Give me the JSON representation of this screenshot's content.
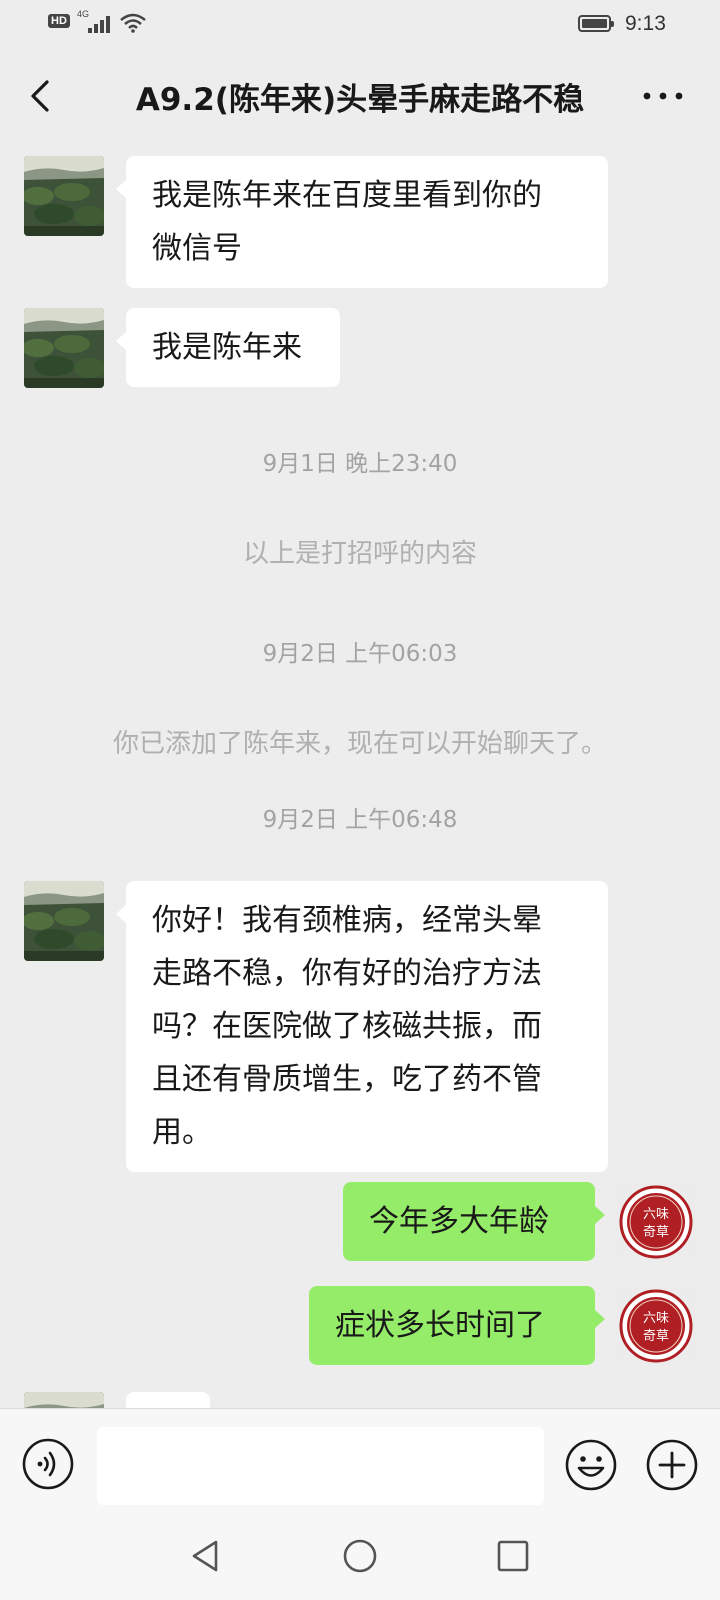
{
  "status_bar": {
    "hd": "HD",
    "network": "4G",
    "time": "9:13"
  },
  "header": {
    "title": "A9.2(陈年来)头晕手麻走路不稳"
  },
  "messages": [
    {
      "lines": [
        "我是陈年来在百度里看到你的",
        "微信号"
      ]
    },
    {
      "lines": [
        "我是陈年来"
      ]
    },
    {
      "lines": [
        "你好！我有颈椎病，经常头晕",
        "走路不稳，你有好的治疗方法",
        "吗？在医院做了核磁共振，而",
        "且还有骨质增生，吃了药不管",
        "用。"
      ]
    },
    {
      "lines": [
        "今年多大年龄"
      ]
    },
    {
      "lines": [
        "症状多长时间了"
      ]
    }
  ],
  "system": {
    "time1": "9月1日 晚上23:40",
    "greeting_note": "以上是打招呼的内容",
    "time2": "9月2日 上午06:03",
    "added_note": "你已添加了陈年来，现在可以开始聊天了。",
    "time3": "9月2日 上午06:48"
  },
  "seal": {
    "text": "六味奇草",
    "color": "#b01f24"
  },
  "colors": {
    "outgoing_bubble": "#95ec69",
    "incoming_bubble": "#ffffff",
    "background": "#ededed"
  },
  "icons": [
    "back-icon",
    "more-icon",
    "voice-icon",
    "emoji-icon",
    "plus-icon",
    "nav-back-icon",
    "nav-home-icon",
    "nav-recent-icon"
  ],
  "input": {
    "value": ""
  }
}
